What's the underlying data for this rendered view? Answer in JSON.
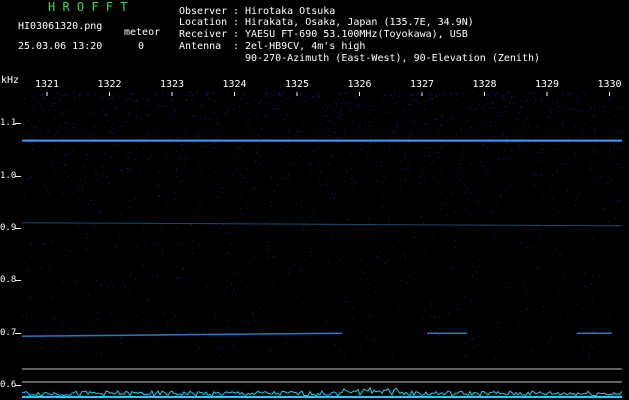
{
  "brand": "H R O F F T",
  "file_name": "HI03061320.png",
  "timestamp": "25.03.06 13:20",
  "meteor_label": "meteor",
  "meteor_count": "0",
  "info": [
    {
      "key": "Observer",
      "value": "Hirotaka Otsuka"
    },
    {
      "key": "Location",
      "value": "Hirakata, Osaka, Japan (135.7E, 34.9N)"
    },
    {
      "key": "Receiver",
      "value": "YAESU FT-690 53.100MHz(Toyokawa), USB"
    },
    {
      "key": "Antenna",
      "value": "2el-HB9CV, 4m's high"
    }
  ],
  "antenna_line2": "90-270-Azimuth (East-West), 90-Elevation (Zenith)",
  "y_unit": "kHz",
  "y_ticks": [
    "1.1",
    "1.0",
    "0.9",
    "0.8",
    "0.7",
    "0.6"
  ],
  "x_ticks": [
    "1321",
    "1322",
    "1323",
    "1324",
    "1325",
    "1326",
    "1327",
    "1328",
    "1329",
    "1330"
  ],
  "colors": {
    "background": "#000000",
    "signal": "#3aa0ff",
    "noise": "#1a2a9a",
    "brand": "#33dd55",
    "baseline": "#22ccff"
  },
  "chart_data": {
    "type": "heatmap",
    "xlabel": "",
    "ylabel": "kHz",
    "x_range": [
      1320.6,
      1330.2
    ],
    "y_range": [
      0.575,
      1.16
    ],
    "carriers": [
      {
        "freq_khz": 1.067,
        "intensity": 1.0
      },
      {
        "freq_khz": 0.91,
        "intensity": 0.45
      },
      {
        "freq_khz": 0.695,
        "intensity": 0.5
      }
    ],
    "meteor_count": 0
  }
}
